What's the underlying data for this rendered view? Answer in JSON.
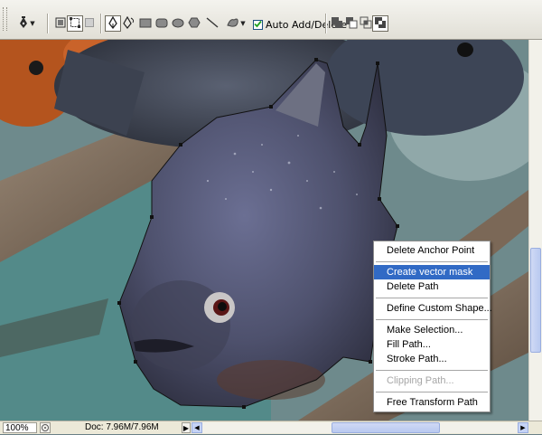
{
  "options_bar": {
    "tools": [
      "pen-tool-icon",
      "shape-layers-icon",
      "paths-icon",
      "fill-pixels-icon",
      "pen-icon",
      "freeform-pen-icon",
      "rectangle-icon",
      "rounded-rectangle-icon",
      "ellipse-icon",
      "polygon-icon",
      "line-icon",
      "custom-shape-icon",
      "add-to-path-icon",
      "subtract-path-icon",
      "intersect-path-icon",
      "exclude-path-icon"
    ],
    "auto_add_delete": {
      "label": "Auto Add/Delete",
      "checked": true
    }
  },
  "context_menu": {
    "items": [
      {
        "label": "Delete Anchor Point",
        "state": "normal"
      },
      {
        "label": "Create vector mask",
        "state": "highlight"
      },
      {
        "label": "Delete Path",
        "state": "normal"
      },
      {
        "label": "Define Custom Shape...",
        "state": "normal"
      },
      {
        "label": "Make Selection...",
        "state": "normal"
      },
      {
        "label": "Fill Path...",
        "state": "normal"
      },
      {
        "label": "Stroke Path...",
        "state": "normal"
      },
      {
        "label": "Clipping Path...",
        "state": "disabled"
      },
      {
        "label": "Free Transform Path",
        "state": "normal"
      }
    ]
  },
  "status_bar": {
    "zoom": "100%",
    "doc_size": "Doc: 7.96M/7.96M"
  },
  "colors": {
    "menu_highlight": "#316ac5",
    "path_anchor": "#1a1a1a"
  }
}
